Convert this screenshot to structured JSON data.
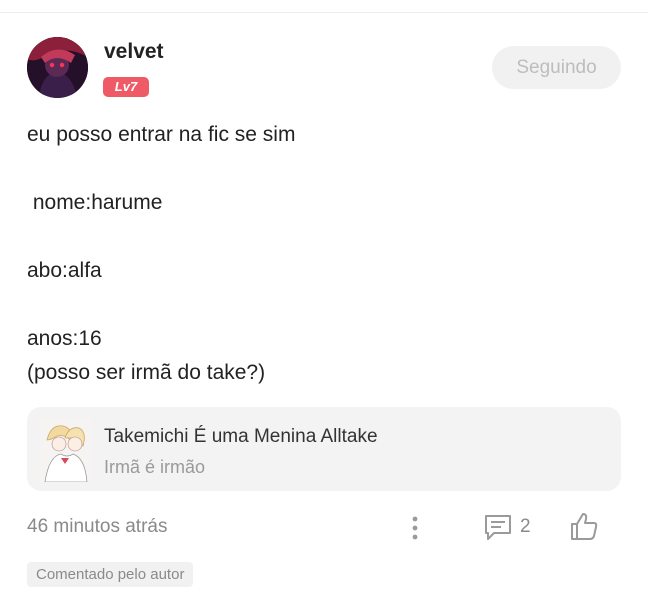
{
  "post": {
    "author": "velvet",
    "level": "Lv7",
    "follow_label": "Seguindo",
    "lines": [
      "eu posso entrar na fic se sim",
      "",
      " nome:harume",
      "",
      "abo:alfa",
      "",
      "anos:16",
      "(posso ser irmã do take?)"
    ],
    "card": {
      "title": "Takemichi É uma Menina Alltake",
      "subtitle": "Irmã é irmão"
    },
    "timestamp": "46 minutos atrás",
    "comment_count": "2",
    "badge": "Comentado pelo autor"
  },
  "icons": {
    "more": "more-vertical-icon",
    "comment": "comment-icon",
    "like": "thumbs-up-icon"
  },
  "colors": {
    "level_badge": "#ee5a66",
    "icon_gray": "#9a9a9a"
  }
}
